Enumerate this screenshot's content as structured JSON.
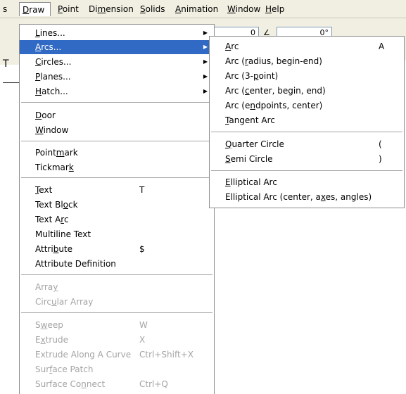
{
  "menubar": {
    "items": [
      {
        "label": "s"
      },
      {
        "label": "Draw",
        "mnemonic": "D"
      },
      {
        "label": "Point",
        "mnemonic": "P"
      },
      {
        "label": "Dimension",
        "mnemonic": "m"
      },
      {
        "label": "Solids",
        "mnemonic": "S"
      },
      {
        "label": "Animation",
        "mnemonic": "A"
      },
      {
        "label": "Window",
        "mnemonic": "W"
      },
      {
        "label": "Help",
        "mnemonic": "H"
      }
    ]
  },
  "toolbar": {
    "field_value_1": "0",
    "field_value_2": "0°",
    "left_letter": "T"
  },
  "draw_menu": {
    "items": [
      {
        "label": "Lines...",
        "submenu": true
      },
      {
        "label": "Arcs...",
        "submenu": true,
        "highlighted": true
      },
      {
        "label": "Circles...",
        "submenu": true
      },
      {
        "label": "Planes...",
        "submenu": true
      },
      {
        "label": "Hatch...",
        "submenu": true
      },
      {
        "label": "Door"
      },
      {
        "label": "Window"
      },
      {
        "label": "Pointmark"
      },
      {
        "label": "Tickmark"
      },
      {
        "label": "Text",
        "shortcut": "T"
      },
      {
        "label": "Text Block"
      },
      {
        "label": "Text Arc"
      },
      {
        "label": "Multiline Text"
      },
      {
        "label": "Attribute",
        "shortcut": "$"
      },
      {
        "label": "Attribute Definition"
      },
      {
        "label": "Array",
        "disabled": true
      },
      {
        "label": "Circular Array",
        "disabled": true
      },
      {
        "label": "Sweep",
        "shortcut": "W",
        "disabled": true
      },
      {
        "label": "Extrude",
        "shortcut": "X",
        "disabled": true
      },
      {
        "label": "Extrude Along A Curve",
        "shortcut": "Ctrl+Shift+X",
        "disabled": true
      },
      {
        "label": "Surface Patch",
        "disabled": true
      },
      {
        "label": "Surface Connect",
        "shortcut": "Ctrl+Q",
        "disabled": true
      }
    ]
  },
  "arcs_submenu": {
    "items": [
      {
        "label": "Arc",
        "shortcut": "A"
      },
      {
        "label": "Arc (radius, begin-end)"
      },
      {
        "label": "Arc (3-point)"
      },
      {
        "label": "Arc (center, begin, end)"
      },
      {
        "label": "Arc (endpoints, center)"
      },
      {
        "label": "Tangent Arc"
      },
      {
        "label": "Quarter Circle",
        "shortcut": "("
      },
      {
        "label": "Semi Circle",
        "shortcut": ")"
      },
      {
        "label": "Elliptical Arc"
      },
      {
        "label": "Elliptical Arc (center, axes, angles)"
      }
    ]
  },
  "icons": {
    "submenu_arrow": "triangle-right-icon"
  },
  "colors": {
    "highlight": "#316ac5",
    "disabled_text": "#a4a4a4",
    "menubar_bg": "#f1efe2"
  }
}
